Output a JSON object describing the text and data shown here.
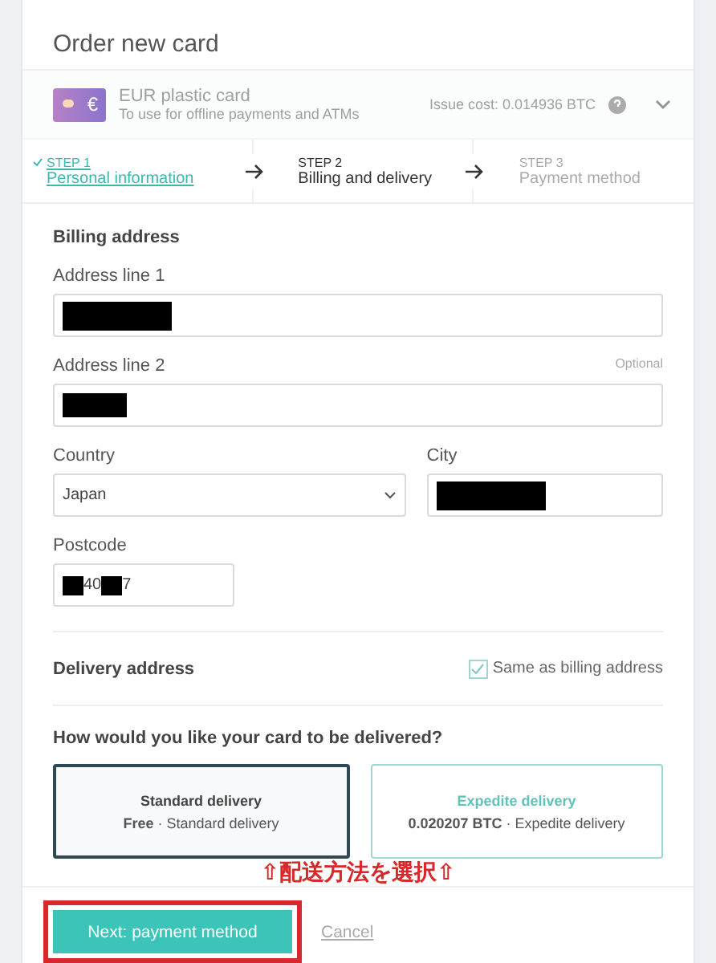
{
  "header": {
    "title": "Order new card"
  },
  "card_product": {
    "badge": "€",
    "name": "EUR plastic card",
    "description": "To use for offline payments and ATMs",
    "issue_cost": "Issue cost: 0.014936 BTC",
    "disabled": true
  },
  "steps": [
    {
      "step": "STEP 1",
      "label": "Personal information",
      "completed": true,
      "selected": false
    },
    {
      "step": "STEP 2",
      "label": "Billing and delivery",
      "completed": false,
      "selected": true
    },
    {
      "step": "STEP 3",
      "label": "Payment method",
      "completed": false,
      "selected": false
    }
  ],
  "billing": {
    "title": "Billing address",
    "address_line_1": {
      "label": "Address line 1",
      "value": [
        {
          "kind": "redacted"
        }
      ]
    },
    "address_line_2": {
      "label": "Address line 2",
      "hint": "Optional",
      "value": [
        {
          "kind": "redacted"
        }
      ]
    },
    "country": {
      "label": "Country",
      "value": "Japan"
    },
    "city": {
      "label": "City",
      "value": [
        {
          "kind": "redacted"
        }
      ]
    },
    "postcode": {
      "label": "Postcode",
      "value": [
        {
          "kind": "redacted"
        },
        {
          "kind": "text",
          "text": "40"
        },
        {
          "kind": "redacted"
        },
        {
          "kind": "text",
          "text": "7"
        }
      ]
    }
  },
  "delivery_address": {
    "title": "Delivery address",
    "same_as_billing": {
      "label": "Same as billing address",
      "checked": true
    }
  },
  "delivery": {
    "question": "How would you like your card to be delivered?",
    "options": [
      {
        "title": "Standard delivery",
        "price": "Free",
        "detail": "· Standard delivery",
        "selected": true
      },
      {
        "title": "Expedite delivery",
        "price": "0.020207 BTC",
        "detail": "· Expedite delivery",
        "selected": false
      }
    ]
  },
  "annotation": {
    "text": "⇧配送方法を選択⇧"
  },
  "footer": {
    "next": "Next: payment method",
    "cancel": "Cancel"
  }
}
